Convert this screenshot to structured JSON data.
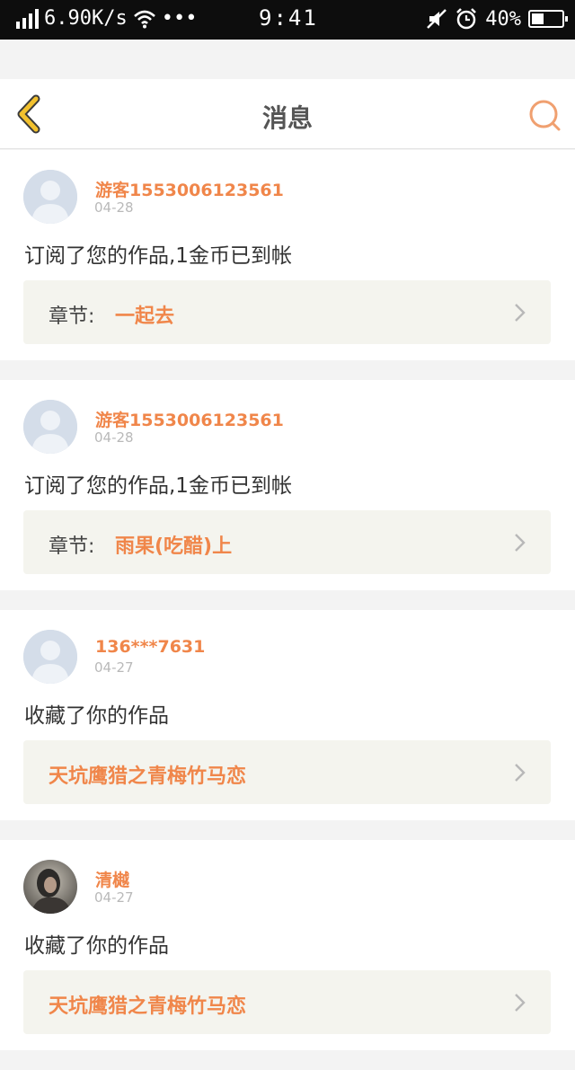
{
  "status_bar": {
    "speed": "6.90K/s",
    "dots": "•••",
    "time": "9:41",
    "battery_percent": "40%",
    "battery_level": 0.4,
    "icons": [
      "signal-icon",
      "wifi-icon",
      "mute-icon",
      "alarm-icon",
      "battery-icon"
    ]
  },
  "header": {
    "title": "消息",
    "back_icon": "chevron-left-icon",
    "search_icon": "search-icon"
  },
  "colors": {
    "accent": "#f0864a",
    "back_arrow": "#f2c12e",
    "background": "#f3f3f3",
    "work_box": "#f4f4ee"
  },
  "notifications": [
    {
      "username": "游客1553006123561",
      "date": "04-28",
      "action": "订阅了您的作品,1金币已到帐",
      "chapter_label": "章节:",
      "work_title": "一起去",
      "avatar": "default-avatar-icon"
    },
    {
      "username": "游客1553006123561",
      "date": "04-28",
      "action": "订阅了您的作品,1金币已到帐",
      "chapter_label": "章节:",
      "work_title": "雨果(吃醋)上",
      "avatar": "default-avatar-icon"
    },
    {
      "username": "136***7631",
      "date": "04-27",
      "action": "收藏了你的作品",
      "chapter_label": "",
      "work_title": "天坑鹰猎之青梅竹马恋",
      "avatar": "default-avatar-icon"
    },
    {
      "username": "清樾",
      "date": "04-27",
      "action": "收藏了你的作品",
      "chapter_label": "",
      "work_title": "天坑鹰猎之青梅竹马恋",
      "avatar": "photo-avatar"
    }
  ]
}
